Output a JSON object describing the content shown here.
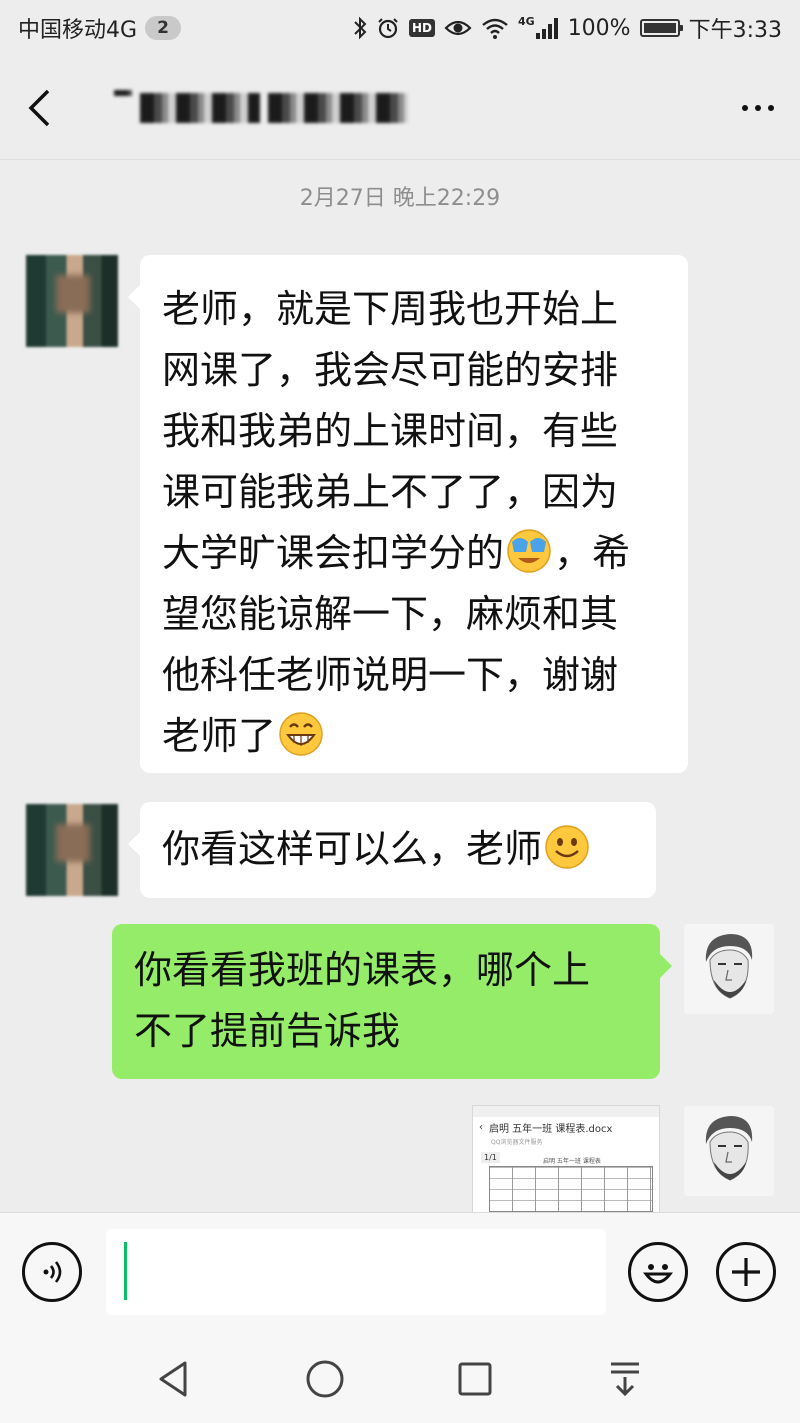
{
  "status_bar": {
    "carrier": "中国移动4G",
    "sim_badge": "2",
    "network_tag": "4G",
    "battery_percent": "100%",
    "battery_level": 1.0,
    "time": "下午3:33",
    "icons": [
      "bluetooth-icon",
      "alarm-icon",
      "hd-icon",
      "eye-icon",
      "wifi-icon",
      "signal-icon",
      "battery-icon"
    ]
  },
  "header": {
    "back_icon": "chevron-left-icon",
    "more_icon": "more-dots-icon"
  },
  "chat": {
    "timestamp": "2月27日 晚上22:29",
    "messages": [
      {
        "side": "left",
        "lines": [
          "老师，就是下周我也开始上",
          "网课了，我会尽可能的安排",
          "我和我弟的上课时间，有些",
          "课可能我弟上不了了，因为",
          "大学旷课会扣学分的",
          "，希",
          "望您能谅解一下，麻烦和其",
          "他科任老师说明一下，谢谢",
          "老师了"
        ]
      },
      {
        "side": "left",
        "text": "你看这样可以么，老师"
      },
      {
        "side": "right",
        "lines": [
          "你看看我班的课表，哪个上",
          "不了提前告诉我"
        ]
      }
    ],
    "file_preview": {
      "title": "启明 五年一班 课程表.docx",
      "subtitle": "QQ浏览器文件服务",
      "page": "1/1",
      "caption": "启明 五年一班 课程表"
    }
  },
  "input_bar": {
    "voice_icon": "voice-icon",
    "emoji_icon": "emoji-icon",
    "add_icon": "plus-icon",
    "value": ""
  },
  "nav_bar": {
    "icons": [
      "back-triangle-icon",
      "home-circle-icon",
      "recents-square-icon",
      "notification-pull-icon"
    ]
  }
}
